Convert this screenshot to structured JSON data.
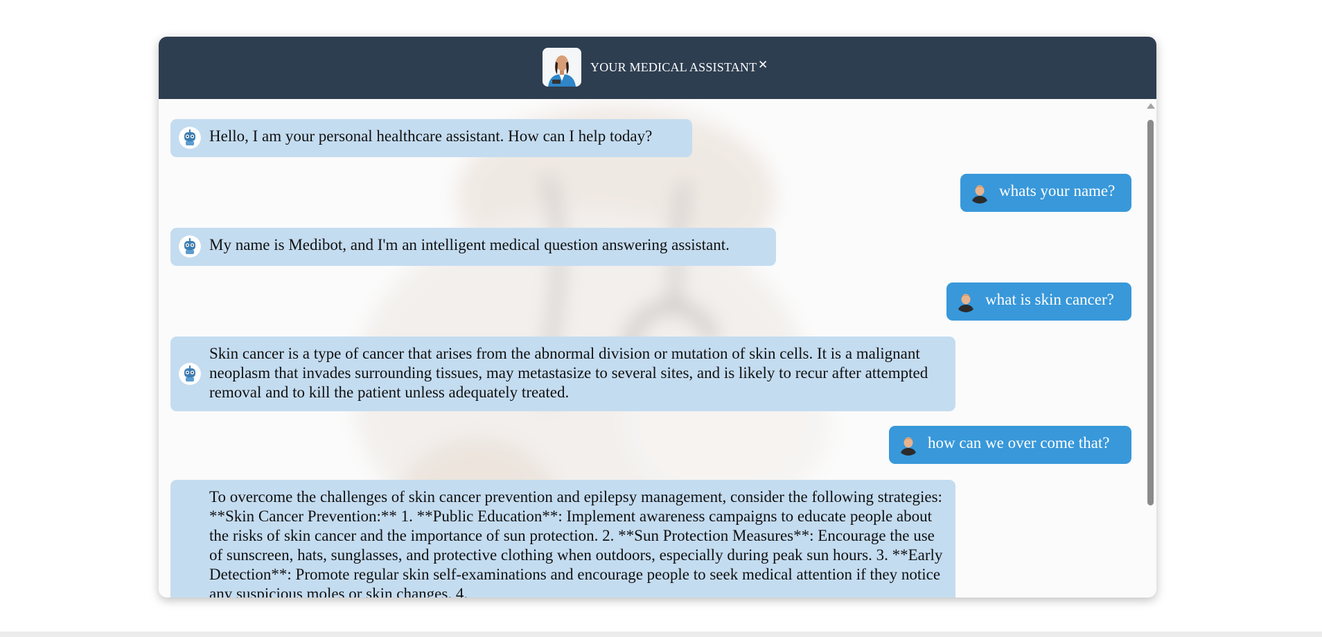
{
  "header": {
    "title": "YOUR MEDICAL ASSISTANT",
    "close_glyph": "✕",
    "avatar_icon": "doctor-avatar-icon"
  },
  "messages": [
    {
      "role": "bot",
      "icon": "robot-avatar-icon",
      "text": "Hello, I am your personal healthcare assistant. How can I help today?"
    },
    {
      "role": "user",
      "icon": "user-avatar-icon",
      "text": "whats your name?"
    },
    {
      "role": "bot",
      "icon": "robot-avatar-icon",
      "text": "My name is Medibot, and I'm an intelligent medical question answering assistant."
    },
    {
      "role": "user",
      "icon": "user-avatar-icon",
      "text": "what is skin cancer?"
    },
    {
      "role": "bot",
      "icon": "robot-avatar-icon",
      "text": "Skin cancer is a type of cancer that arises from the abnormal division or mutation of skin cells. It is a malignant neoplasm that invades surrounding tissues, may metastasize to several sites, and is likely to recur after attempted removal and to kill the patient unless adequately treated."
    },
    {
      "role": "user",
      "icon": "user-avatar-icon",
      "text": "how can we over come that?"
    },
    {
      "role": "bot",
      "icon": "robot-avatar-icon",
      "text": "To overcome the challenges of skin cancer prevention and epilepsy management, consider the following strategies: **Skin Cancer Prevention:** 1. **Public Education**: Implement awareness campaigns to educate people about the risks of skin cancer and the importance of sun protection. 2. **Sun Protection Measures**: Encourage the use of sunscreen, hats, sunglasses, and protective clothing when outdoors, especially during peak sun hours. 3. **Early Detection**: Promote regular skin self-examinations and encourage people to seek medical attention if they notice any suspicious moles or skin changes. 4."
    }
  ],
  "colors": {
    "header_bg": "#2e3e51",
    "bot_bubble": "#c4dcf0",
    "user_bubble": "#3898da"
  }
}
